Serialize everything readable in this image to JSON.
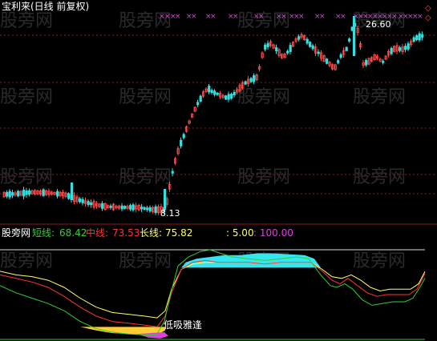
{
  "title": "宝利来(日线 前复权)",
  "price_panel": {
    "high_label": "26.60",
    "low_label": "8.13",
    "marker_glyph": "×",
    "diamond_glyph": "◇"
  },
  "indicator_panel": {
    "name": "股旁网",
    "short_label": "短线:",
    "short_value": "68.42",
    "mid_label": "中线:",
    "mid_value": "73.53",
    "long_label": "长线:",
    "long_value": "75.82",
    "level_a": ": 5.00",
    "level_b": ": 100.00",
    "signal_text": "低吸雅逢"
  },
  "watermark": "股旁网",
  "colors": {
    "up": "#ff4d4d",
    "down": "#33e0e0",
    "short": "#33cc33",
    "mid": "#ff3333",
    "long": "#ffff66",
    "cyan_fill": "#33e6f0",
    "yellow_fill": "#ffcc33",
    "magenta": "#e040e0",
    "grid": "#8b1a1a"
  },
  "chart_data": {
    "type": "candlestick",
    "price_high": 26.6,
    "price_low": 8.13,
    "indicator_range": [
      0,
      100
    ],
    "series": [
      {
        "name": "短线",
        "last": 68.42
      },
      {
        "name": "中线",
        "last": 73.53
      },
      {
        "name": "长线",
        "last": 75.82
      }
    ]
  }
}
